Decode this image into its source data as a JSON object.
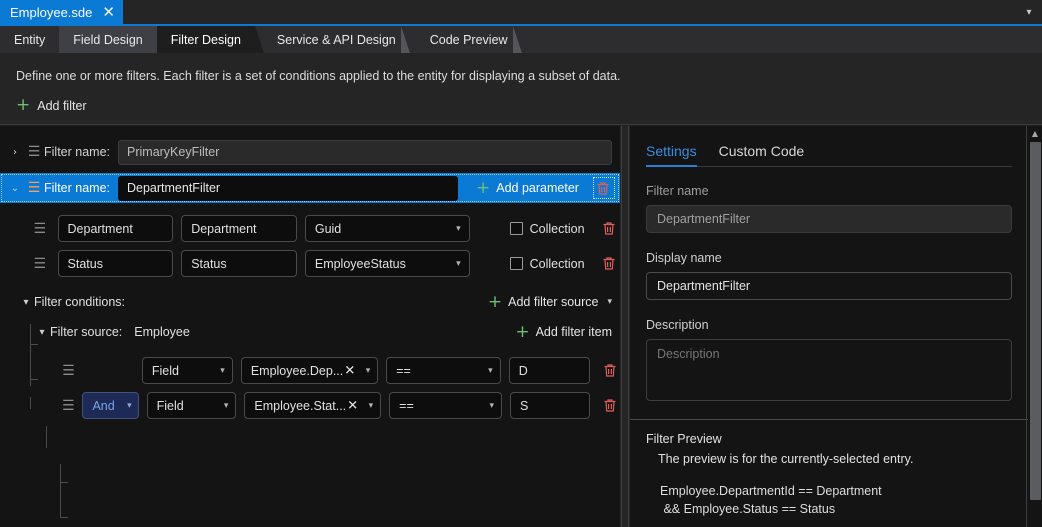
{
  "window": {
    "document_tab": {
      "label": "Employee.sde",
      "close_icon": "close-icon"
    },
    "overflow_icon": "chevron-down-icon"
  },
  "designer_tabs": [
    {
      "label": "Entity",
      "state": "normal"
    },
    {
      "label": "Field Design",
      "state": "hovered"
    },
    {
      "label": "Filter Design",
      "state": "active"
    },
    {
      "label": "Service & API Design",
      "state": "normal"
    },
    {
      "label": "Code Preview",
      "state": "normal"
    }
  ],
  "header": {
    "description": "Define one or more filters. Each filter is a set of conditions applied to the entity for displaying a subset of data.",
    "add_filter_label": "Add filter",
    "plus_icon": "plus-icon"
  },
  "filters": [
    {
      "expanded": false,
      "selected": false,
      "name_label": "Filter name:",
      "name_value": "PrimaryKeyFilter",
      "chevron": "›",
      "grip_icon": "drag-handle-icon"
    },
    {
      "expanded": true,
      "selected": true,
      "name_label": "Filter name:",
      "name_value": "DepartmentFilter",
      "chevron": "⌄",
      "grip_icon": "drag-handle-icon",
      "add_parameter_label": "Add parameter",
      "delete_icon": "trash-icon"
    }
  ],
  "parameters": {
    "rows": [
      {
        "name": "Department",
        "display_name": "Department",
        "type": "Guid",
        "collection_label": "Collection",
        "collection_checked": false
      },
      {
        "name": "Status",
        "display_name": "Status",
        "type": "EmployeeStatus",
        "collection_label": "Collection",
        "collection_checked": false
      }
    ]
  },
  "conditions": {
    "title": "Filter conditions:",
    "add_source_label": "Add filter source",
    "add_item_label": "Add filter item",
    "source_label": "Filter source:",
    "source_value": "Employee",
    "rows": [
      {
        "logic": "",
        "kind": "Field",
        "target": "Employee.Dep...",
        "operator": "==",
        "value": "D",
        "clear_icon": "close-icon",
        "delete_icon": "trash-icon"
      },
      {
        "logic": "And",
        "kind": "Field",
        "target": "Employee.Stat...",
        "operator": "==",
        "value": "S",
        "clear_icon": "close-icon",
        "delete_icon": "trash-icon"
      }
    ]
  },
  "settings": {
    "tabs": [
      {
        "label": "Settings",
        "active": true
      },
      {
        "label": "Custom Code",
        "active": false
      }
    ],
    "filter_name_label": "Filter name",
    "filter_name_value": "DepartmentFilter",
    "display_name_label": "Display name",
    "display_name_value": "DepartmentFilter",
    "description_label": "Description",
    "description_placeholder": "Description",
    "description_value": ""
  },
  "preview": {
    "title": "Filter Preview",
    "subtitle": "The preview is for the currently-selected entry.",
    "code": "Employee.DepartmentId == Department\n && Employee.Status == Status"
  },
  "colors": {
    "accent_blue": "#0b7ad4",
    "green": "#6dbf73",
    "danger_red": "#e05c5c",
    "link_blue": "#3c8ce0"
  }
}
